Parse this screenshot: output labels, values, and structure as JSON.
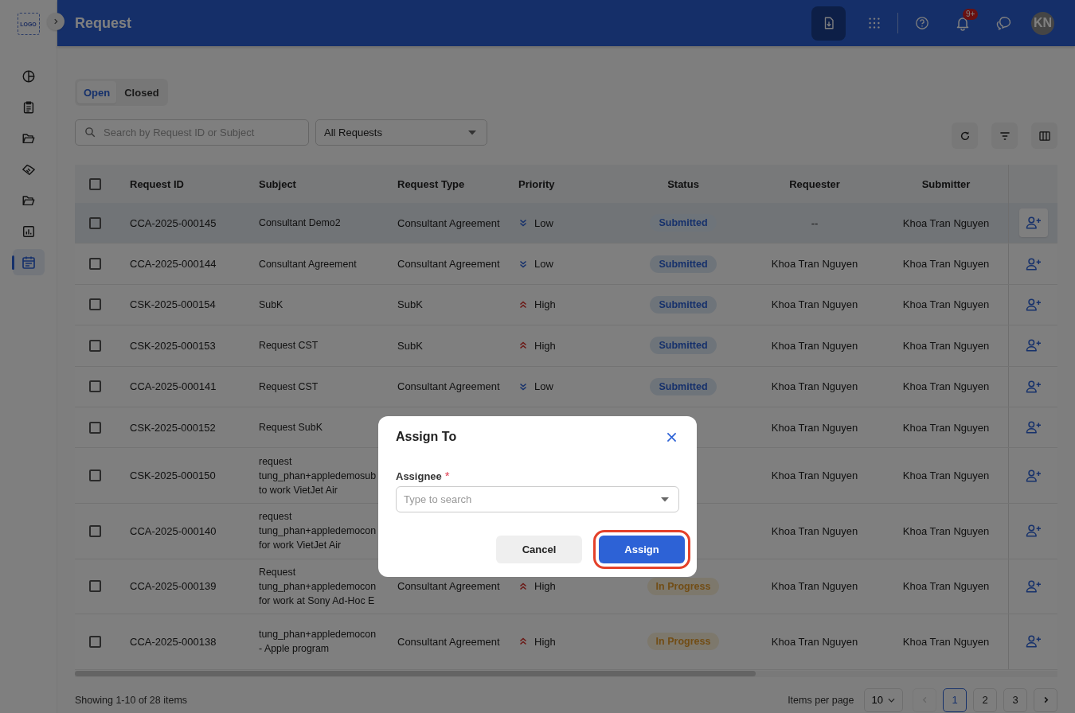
{
  "sidebar": {
    "logo": "LOGO",
    "items": [
      {
        "selected": false
      },
      {
        "selected": false
      },
      {
        "selected": false
      },
      {
        "selected": false
      },
      {
        "selected": false
      },
      {
        "selected": false
      },
      {
        "selected": true
      }
    ]
  },
  "header": {
    "title": "Request",
    "notification_badge": "9+",
    "avatar": "KN"
  },
  "tabs": [
    {
      "label": "Open",
      "selected": true
    },
    {
      "label": "Closed",
      "selected": false
    }
  ],
  "search": {
    "placeholder": "Search by Request ID or Subject"
  },
  "filter_dropdown": {
    "value": "All Requests"
  },
  "table": {
    "select_all_checked": false,
    "columns": [
      "Request ID",
      "Subject",
      "Request Type",
      "Priority",
      "Status",
      "Requester",
      "Submitter"
    ],
    "rows": [
      {
        "checked": false,
        "highlighted": true,
        "id": "CCA-2025-000145",
        "subject": [
          "Consultant Demo2"
        ],
        "type": "Consultant Agreement",
        "priority": {
          "kind": "low",
          "label": "Low"
        },
        "status": {
          "kind": "submitted",
          "label": "Submitted"
        },
        "requester": "--",
        "submitter": "Khoa Tran Nguyen"
      },
      {
        "checked": false,
        "highlighted": false,
        "id": "CCA-2025-000144",
        "subject": [
          "Consultant Agreement"
        ],
        "type": "Consultant Agreement",
        "priority": {
          "kind": "low",
          "label": "Low"
        },
        "status": {
          "kind": "submitted",
          "label": "Submitted"
        },
        "requester": "Khoa Tran Nguyen",
        "submitter": "Khoa Tran Nguyen"
      },
      {
        "checked": false,
        "highlighted": false,
        "id": "CSK-2025-000154",
        "subject": [
          "SubK"
        ],
        "type": "SubK",
        "priority": {
          "kind": "high",
          "label": "High"
        },
        "status": {
          "kind": "submitted",
          "label": "Submitted"
        },
        "requester": "Khoa Tran Nguyen",
        "submitter": "Khoa Tran Nguyen"
      },
      {
        "checked": false,
        "highlighted": false,
        "id": "CSK-2025-000153",
        "subject": [
          "Request CST"
        ],
        "type": "SubK",
        "priority": {
          "kind": "high",
          "label": "High"
        },
        "status": {
          "kind": "submitted",
          "label": "Submitted"
        },
        "requester": "Khoa Tran Nguyen",
        "submitter": "Khoa Tran Nguyen"
      },
      {
        "checked": false,
        "highlighted": false,
        "id": "CCA-2025-000141",
        "subject": [
          "Request CST"
        ],
        "type": "Consultant Agreement",
        "priority": {
          "kind": "low",
          "label": "Low"
        },
        "status": {
          "kind": "submitted",
          "label": "Submitted"
        },
        "requester": "Khoa Tran Nguyen",
        "submitter": "Khoa Tran Nguyen"
      },
      {
        "checked": false,
        "highlighted": false,
        "id": "CSK-2025-000152",
        "subject": [
          "Request SubK"
        ],
        "requester": "Khoa Tran Nguyen",
        "submitter": "Khoa Tran Nguyen"
      },
      {
        "checked": false,
        "highlighted": false,
        "id": "CSK-2025-000150",
        "subject": [
          "request",
          "tung_phan+appledemosub",
          "to work VietJet Air"
        ],
        "requester": "Khoa Tran Nguyen",
        "submitter": "Khoa Tran Nguyen"
      },
      {
        "checked": false,
        "highlighted": false,
        "id": "CCA-2025-000140",
        "subject": [
          "request",
          "tung_phan+appledemocon",
          "for work VietJet Air"
        ],
        "requester": "Khoa Tran Nguyen",
        "submitter": "Khoa Tran Nguyen"
      },
      {
        "checked": false,
        "highlighted": false,
        "id": "CCA-2025-000139",
        "subject": [
          "Request",
          "tung_phan+appledemocon",
          "for work at Sony Ad-Hoc E"
        ],
        "type": "Consultant Agreement",
        "priority": {
          "kind": "high",
          "label": "High"
        },
        "status": {
          "kind": "in_progress",
          "label": "In Progress"
        },
        "requester": "Khoa Tran Nguyen",
        "submitter": "Khoa Tran Nguyen"
      },
      {
        "checked": false,
        "highlighted": false,
        "id": "CCA-2025-000138",
        "subject": [
          "tung_phan+appledemocon",
          "- Apple program"
        ],
        "type": "Consultant Agreement",
        "priority": {
          "kind": "high",
          "label": "High"
        },
        "status": {
          "kind": "in_progress",
          "label": "In Progress"
        },
        "requester": "Khoa Tran Nguyen",
        "submitter": "Khoa Tran Nguyen"
      }
    ]
  },
  "footer": {
    "summary": "Showing 1-10 of 28 items",
    "per_page_label": "Items per page",
    "per_page": "10",
    "prev_disabled": true,
    "pages": [
      {
        "label": "1",
        "selected": true
      },
      {
        "label": "2",
        "selected": false
      },
      {
        "label": "3",
        "selected": false
      }
    ]
  },
  "dialog": {
    "title": "Assign To",
    "field_label": "Assignee",
    "required_mark": "*",
    "placeholder": "Type to search",
    "buttons": [
      {
        "kind": "secondary",
        "label": "Cancel",
        "highlighted": false
      },
      {
        "kind": "primary",
        "label": "Assign",
        "highlighted": true
      }
    ]
  }
}
